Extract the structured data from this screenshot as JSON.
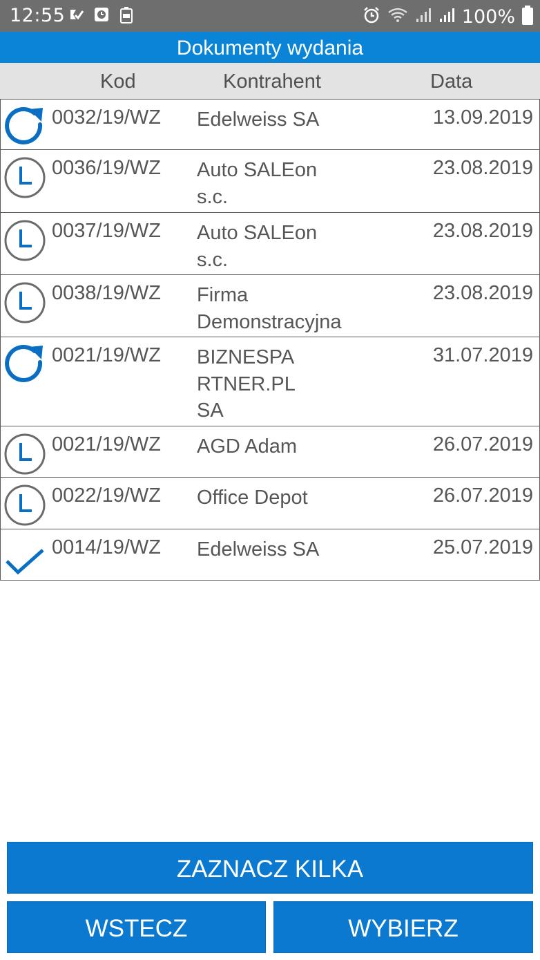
{
  "status_bar": {
    "time": "12:55",
    "battery": "100%"
  },
  "title": "Dokumenty wydania",
  "columns": {
    "kod": "Kod",
    "kontrahent": "Kontrahent",
    "data": "Data"
  },
  "rows": [
    {
      "status_icon": "sync-icon",
      "kod": "0032/19/WZ",
      "kontrahent": "Edelweiss SA",
      "data": "13.09.2019"
    },
    {
      "status_icon": "clock-icon",
      "kod": "0036/19/WZ",
      "kontrahent": "Auto SALEon\ns.c.",
      "data": "23.08.2019"
    },
    {
      "status_icon": "clock-icon",
      "kod": "0037/19/WZ",
      "kontrahent": "Auto SALEon\ns.c.",
      "data": "23.08.2019"
    },
    {
      "status_icon": "clock-icon",
      "kod": "0038/19/WZ",
      "kontrahent": "Firma\nDemonstracyjna",
      "data": "23.08.2019"
    },
    {
      "status_icon": "sync-icon",
      "kod": "0021/19/WZ",
      "kontrahent": "BIZNESPA\nRTNER.PL\nSA",
      "data": "31.07.2019"
    },
    {
      "status_icon": "clock-icon",
      "kod": "0021/19/WZ",
      "kontrahent": "AGD Adam",
      "data": "26.07.2019"
    },
    {
      "status_icon": "clock-icon",
      "kod": "0022/19/WZ",
      "kontrahent": "Office Depot",
      "data": "26.07.2019"
    },
    {
      "status_icon": "check-icon",
      "kod": "0014/19/WZ",
      "kontrahent": "Edelweiss SA",
      "data": "25.07.2019"
    }
  ],
  "buttons": {
    "select_multiple": "ZAZNACZ KILKA",
    "back": "WSTECZ",
    "choose": "WYBIERZ"
  },
  "colors": {
    "accent": "#0a84d6",
    "button": "#0a79cf",
    "header_bg": "#e3e3e3",
    "status_bar": "#6e6e6e"
  }
}
